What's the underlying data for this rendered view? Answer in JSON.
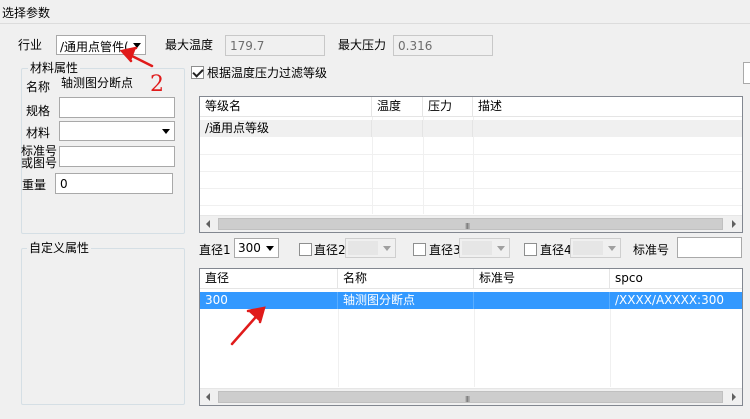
{
  "window": {
    "title": "选择参数"
  },
  "top": {
    "industry_label": "行业",
    "industry_value": "/通用点管件(",
    "max_temp_label": "最大温度",
    "max_temp_value": "179.7",
    "max_pressure_label": "最大压力",
    "max_pressure_value": "0.316"
  },
  "material_group": {
    "title": "材料属性",
    "name_label": "名称",
    "name_value": "轴测图分断点",
    "spec_label": "规格",
    "spec_value": "",
    "material_label": "材料",
    "material_value": "",
    "standard_label_1": "标准号",
    "standard_label_2": "或图号",
    "standard_value": "",
    "weight_label": "重量",
    "weight_value": "0"
  },
  "custom_group": {
    "title": "自定义属性"
  },
  "filter": {
    "checked": true,
    "label": "根据温度压力过滤等级"
  },
  "grade_table": {
    "columns": [
      "等级名",
      "温度",
      "压力",
      "描述"
    ],
    "rows": [
      [
        "/通用点等级",
        "",
        "",
        ""
      ]
    ]
  },
  "diameter_bar": {
    "d1_label": "直径1",
    "d1_value": "300",
    "d2_label": "直径2",
    "d3_label": "直径3",
    "d4_label": "直径4",
    "standard_label": "标准号",
    "standard_value": ""
  },
  "result_table": {
    "columns": [
      "直径",
      "名称",
      "标准号",
      "spco"
    ],
    "rows": [
      [
        "300",
        "轴测图分断点",
        "",
        "/XXXX/AXXXX:300"
      ]
    ],
    "selected_row": 0
  },
  "annotations": {
    "number_label": "2"
  },
  "colors": {
    "selection": "#3399ff",
    "annotation": "#e01b1b"
  }
}
